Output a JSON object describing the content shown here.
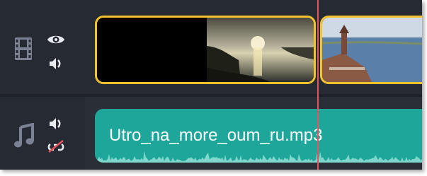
{
  "tracks": {
    "video": {
      "icon": "film-strip-icon",
      "visibility_icon": "eye-icon",
      "sound_icon": "speaker-icon",
      "clips": [
        {
          "thumbnail": "sunset-over-sea"
        },
        {
          "thumbnail": "lighthouse-pier-by-sea"
        }
      ]
    },
    "audio": {
      "icon": "music-note-icon",
      "sound_icon": "speaker-icon",
      "link_icon": "unlink-icon",
      "clips": [
        {
          "name": "Utro_na_more_oum_ru.mp3"
        }
      ]
    }
  },
  "colors": {
    "background": "#262a33",
    "clip_border": "#f2c32e",
    "audio_clip": "#1ea69a",
    "playhead": "#e5535d",
    "icon": "#8a93a6"
  }
}
